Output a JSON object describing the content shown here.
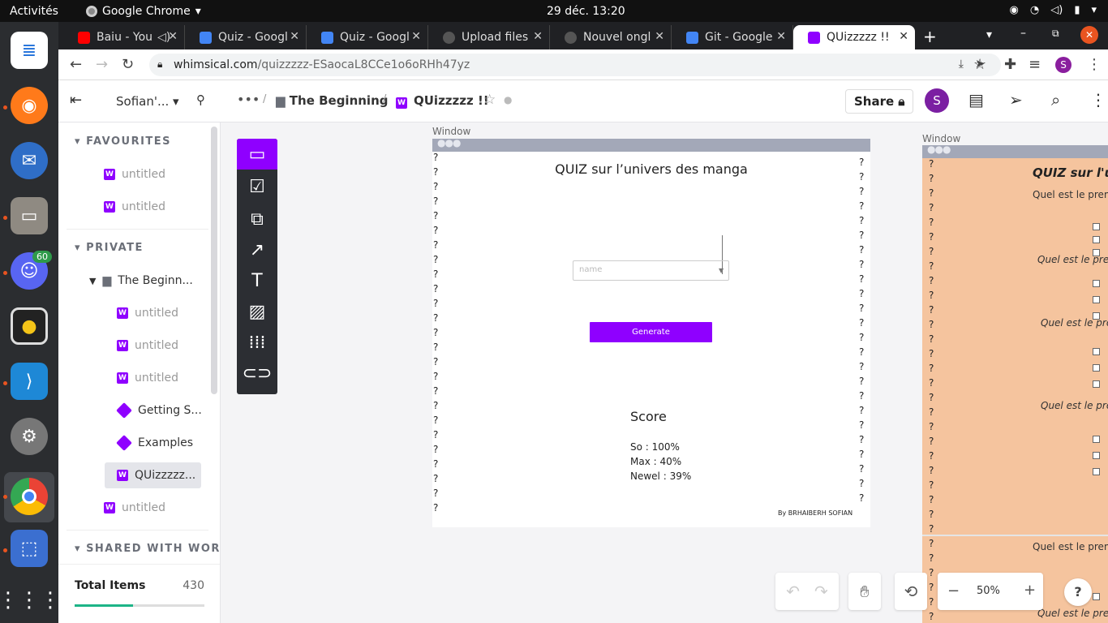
{
  "topbar": {
    "activities": "Activités",
    "app": "Google Chrome",
    "clock": "29 déc.  13:20"
  },
  "dock": {
    "badge": "60",
    "apps": [
      "libreoffice-writer-icon",
      "firefox-icon",
      "thunderbird-icon",
      "files-icon",
      "discord-icon",
      "rhythmbox-icon",
      "vscode-icon",
      "settings-icon",
      "chrome-icon",
      "screenshot-icon",
      "app-grid-icon"
    ]
  },
  "tabs": [
    {
      "label": "Baiu - You",
      "color": "#ff0000"
    },
    {
      "label": "Quiz - Googl",
      "color": "#4285f4"
    },
    {
      "label": "Quiz - Googl",
      "color": "#4285f4"
    },
    {
      "label": "Upload files",
      "color": "#555555"
    },
    {
      "label": "Nouvel ongl",
      "color": "#555555"
    },
    {
      "label": "Git - Google",
      "color": "#4285f4"
    },
    {
      "label": "QUizzzzz !!",
      "color": "#8f00ff"
    }
  ],
  "address": {
    "domain": "whimsical.com",
    "path": "/quizzzzz-ESaocaL8CCe1o6oRHh47yz"
  },
  "profile_letter": "S",
  "workspace": {
    "name": "Sofian'...",
    "breadcrumb_folder": "The Beginning",
    "breadcrumb_doc": "QUizzzzz !!",
    "share": "Share",
    "avatar": "S"
  },
  "sidebar": {
    "fav_header": "FAVOURITES",
    "fav_items": [
      "untitled",
      "untitled"
    ],
    "private_header": "PRIVATE",
    "folder": "The Beginn...",
    "folder_items": [
      "untitled",
      "untitled",
      "untitled"
    ],
    "getting_started": "Getting S...",
    "examples": "Examples",
    "current": "QUizzzzz...",
    "last": "untitled",
    "shared_header": "SHARED WITH WORI",
    "total_label": "Total Items",
    "total_value": "430",
    "progress": 0.45
  },
  "frame1": {
    "window_label": "Window",
    "title": "QUIZ sur l’univers des manga",
    "name_placeholder": "name",
    "generate": "Generate",
    "score_title": "Score",
    "scores": [
      "So : 100%",
      "Max : 40%",
      "Newel : 39%"
    ],
    "credit": "By BRHAIBERH SOFIAN",
    "q": "?"
  },
  "frame2": {
    "window_label": "Window",
    "title": "QUIZ sur l'ur",
    "lines": [
      "Quel est le prem",
      "Quel est le prem",
      "Quel est le prem",
      "Quel est le prem",
      "Quel est le prem",
      "Quel est le prem"
    ]
  },
  "zoom": {
    "value": "50%",
    "minus": "−",
    "plus": "+",
    "help": "?"
  }
}
